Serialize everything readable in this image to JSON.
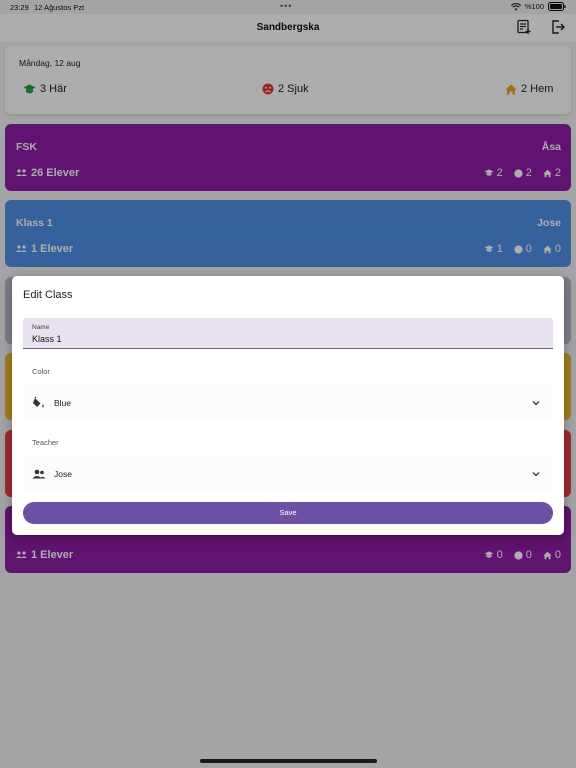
{
  "status_bar": {
    "time": "23:29",
    "date": "12 Ağustos Pzt",
    "dots": "•••",
    "battery": "%100"
  },
  "app_bar": {
    "title": "Sandbergska"
  },
  "summary": {
    "date": "Måndag, 12 aug",
    "present": "3 Här",
    "sick": "2 Sjuk",
    "home": "2 Hem"
  },
  "classes": [
    {
      "name": "FSK",
      "teacher": "Åsa",
      "count": "26 Elever",
      "present": "2",
      "sick": "2",
      "home": "2",
      "color": "#8e1ca6"
    },
    {
      "name": "Klass 1",
      "teacher": "Jose",
      "count": "1 Elever",
      "present": "1",
      "sick": "0",
      "home": "0",
      "color": "#4e8fe6"
    },
    {
      "count": "1 Elever",
      "present": "0",
      "sick": "0",
      "home": "0",
      "color": "#8e1ca6"
    }
  ],
  "colors": {
    "accent": "#6a51a5",
    "green": "#1f9a3a",
    "red": "#e03838",
    "orange": "#f0a020"
  },
  "dialog": {
    "title": "Edit Class",
    "name_label": "Name",
    "name_value": "Klass 1",
    "color_label": "Color",
    "color_value": "Blue",
    "teacher_label": "Teacher",
    "teacher_value": "Jose",
    "save_label": "Save"
  }
}
